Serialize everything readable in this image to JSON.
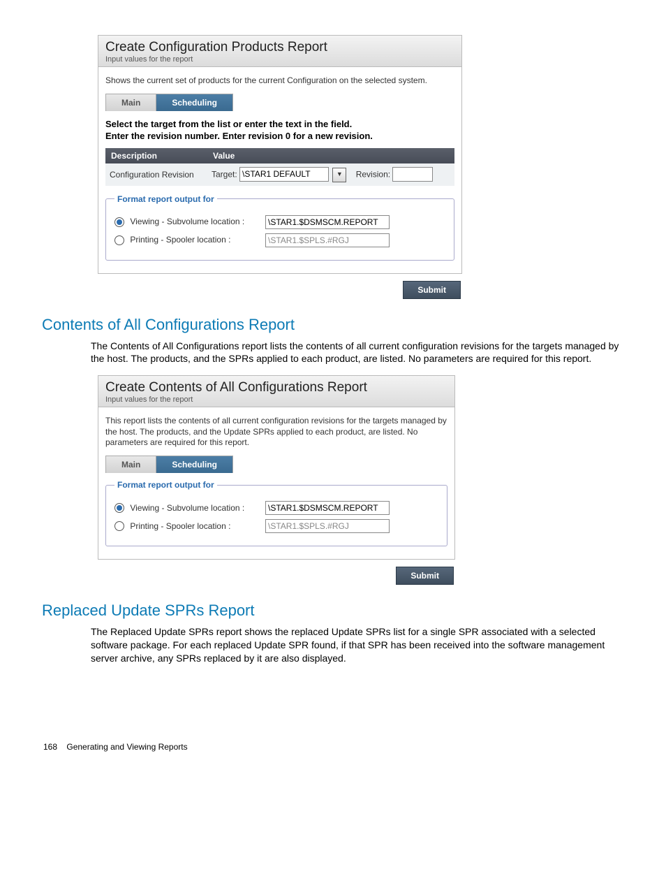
{
  "panel1": {
    "title": "Create Configuration Products Report",
    "subtitle": "Input values for the report",
    "desc": "Shows the current set of products for the current Configuration on the selected system.",
    "tabs": {
      "main": "Main",
      "scheduling": "Scheduling"
    },
    "instruct_line1": "Select the target from the list or enter the text in the field.",
    "instruct_line2": "Enter the revision number. Enter revision 0 for a new revision.",
    "col_desc": "Description",
    "col_value": "Value",
    "row_desc": "Configuration Revision",
    "target_label": "Target:",
    "target_value": "\\STAR1 DEFAULT",
    "revision_label": "Revision:",
    "revision_value": "",
    "fieldset_legend": "Format report output for",
    "opt_viewing_label": "Viewing - Subvolume location :",
    "opt_viewing_value": "\\STAR1.$DSMSCM.REPORT",
    "opt_printing_label": "Printing - Spooler location :",
    "opt_printing_value": "\\STAR1.$SPLS.#RGJ",
    "submit": "Submit"
  },
  "section2": {
    "heading": "Contents of All Configurations Report",
    "body": "The Contents of All Configurations report lists the contents of all current configuration revisions for the targets managed by the host. The products, and the SPRs applied to each product, are listed. No parameters are required for this report."
  },
  "panel2": {
    "title": "Create Contents of All Configurations Report",
    "subtitle": "Input values for the report",
    "desc": "This report lists the contents of all current configuration revisions for the targets managed by the host. The products, and the Update SPRs applied to each product, are listed. No parameters are required for this report.",
    "tabs": {
      "main": "Main",
      "scheduling": "Scheduling"
    },
    "fieldset_legend": "Format report output for",
    "opt_viewing_label": "Viewing - Subvolume location :",
    "opt_viewing_value": "\\STAR1.$DSMSCM.REPORT",
    "opt_printing_label": "Printing - Spooler location :",
    "opt_printing_value": "\\STAR1.$SPLS.#RGJ",
    "submit": "Submit"
  },
  "section3": {
    "heading": "Replaced Update SPRs Report",
    "body": "The Replaced Update SPRs report shows the replaced Update SPRs list for a single SPR associated with a selected software package. For each replaced Update SPR found, if that SPR has been received into the software management server archive, any SPRs replaced by it are also displayed."
  },
  "footer": {
    "page_num": "168",
    "chapter": "Generating and Viewing Reports"
  }
}
